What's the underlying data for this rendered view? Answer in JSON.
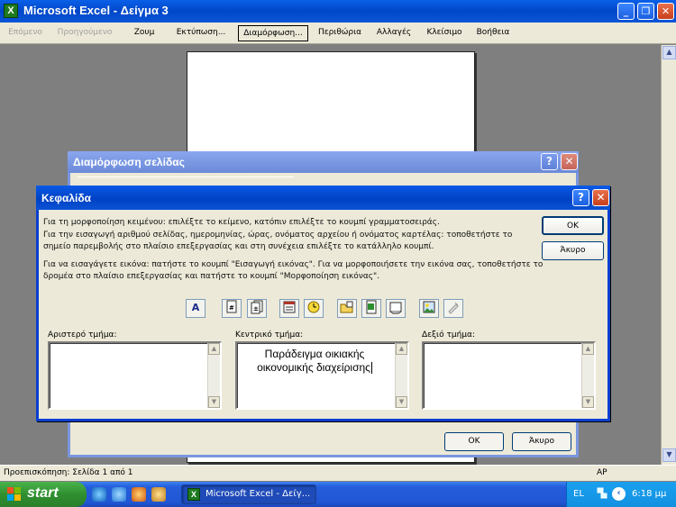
{
  "app": {
    "title": "Microsoft Excel - Δείγμα 3"
  },
  "toolbar": {
    "next": "Επόμενο",
    "previous": "Προηγούμενο",
    "zoom": "Ζουμ",
    "print": "Εκτύπωση...",
    "setup": "Διαμόρφωση...",
    "margins": "Περιθώρια",
    "page_break": "Αλλαγές",
    "close": "Κλείσιμο",
    "help": "Βοήθεια"
  },
  "status": {
    "page_info": "Προεπισκόπηση: Σελίδα 1 από 1",
    "mode": "ΑΡ"
  },
  "page_setup": {
    "title": "Διαμόρφωση σελίδας",
    "ok": "ΟΚ",
    "cancel": "Άκυρο"
  },
  "header_dialog": {
    "title": "Κεφαλίδα",
    "ok": "ΟΚ",
    "cancel": "Άκυρο",
    "instructions": [
      "Για τη μορφοποίηση κειμένου: επιλέξτε το κείμενο, κατόπιν επιλέξτε το κουμπί γραμματοσειράς.",
      "Για την εισαγωγή αριθμού σελίδας, ημερομηνίας, ώρας, ονόματος αρχείου ή ονόματος καρτέλας:  τοποθετήστε το",
      "σημείο παρεμβολής στο πλαίσιο επεξεργασίας και στη συνέχεια επιλέξτε το κατάλληλο κουμπί.",
      "Για να εισαγάγετε εικόνα: πατήστε το κουμπί \"Εισαγωγή εικόνας\". Για να μορφοποιήσετε την εικόνα σας, τοποθετήστε το",
      "δρομέα στο πλαίσιο επεξεργασίας και πατήστε το κουμπί \"Μορφοποίηση εικόνας\"."
    ],
    "left_label": "Αριστερό τμήμα:",
    "center_label": "Κεντρικό τμήμα:",
    "right_label": "Δεξιό τμήμα:",
    "center_line1": "Παράδειγμα οικιακής",
    "center_line2": "οικονομικής διαχείρισης",
    "left_value": "",
    "right_value": "",
    "font_button": "A"
  },
  "taskbar": {
    "start": "start",
    "task": "Microsoft Excel - Δείγ...",
    "lang": "EL",
    "clock": "6:18 μμ"
  },
  "icons": [
    "excel-icon",
    "font-icon",
    "page-number-icon",
    "total-pages-icon",
    "date-icon",
    "time-icon",
    "file-path-icon",
    "file-name-icon",
    "sheet-name-icon",
    "insert-picture-icon",
    "format-picture-icon"
  ]
}
